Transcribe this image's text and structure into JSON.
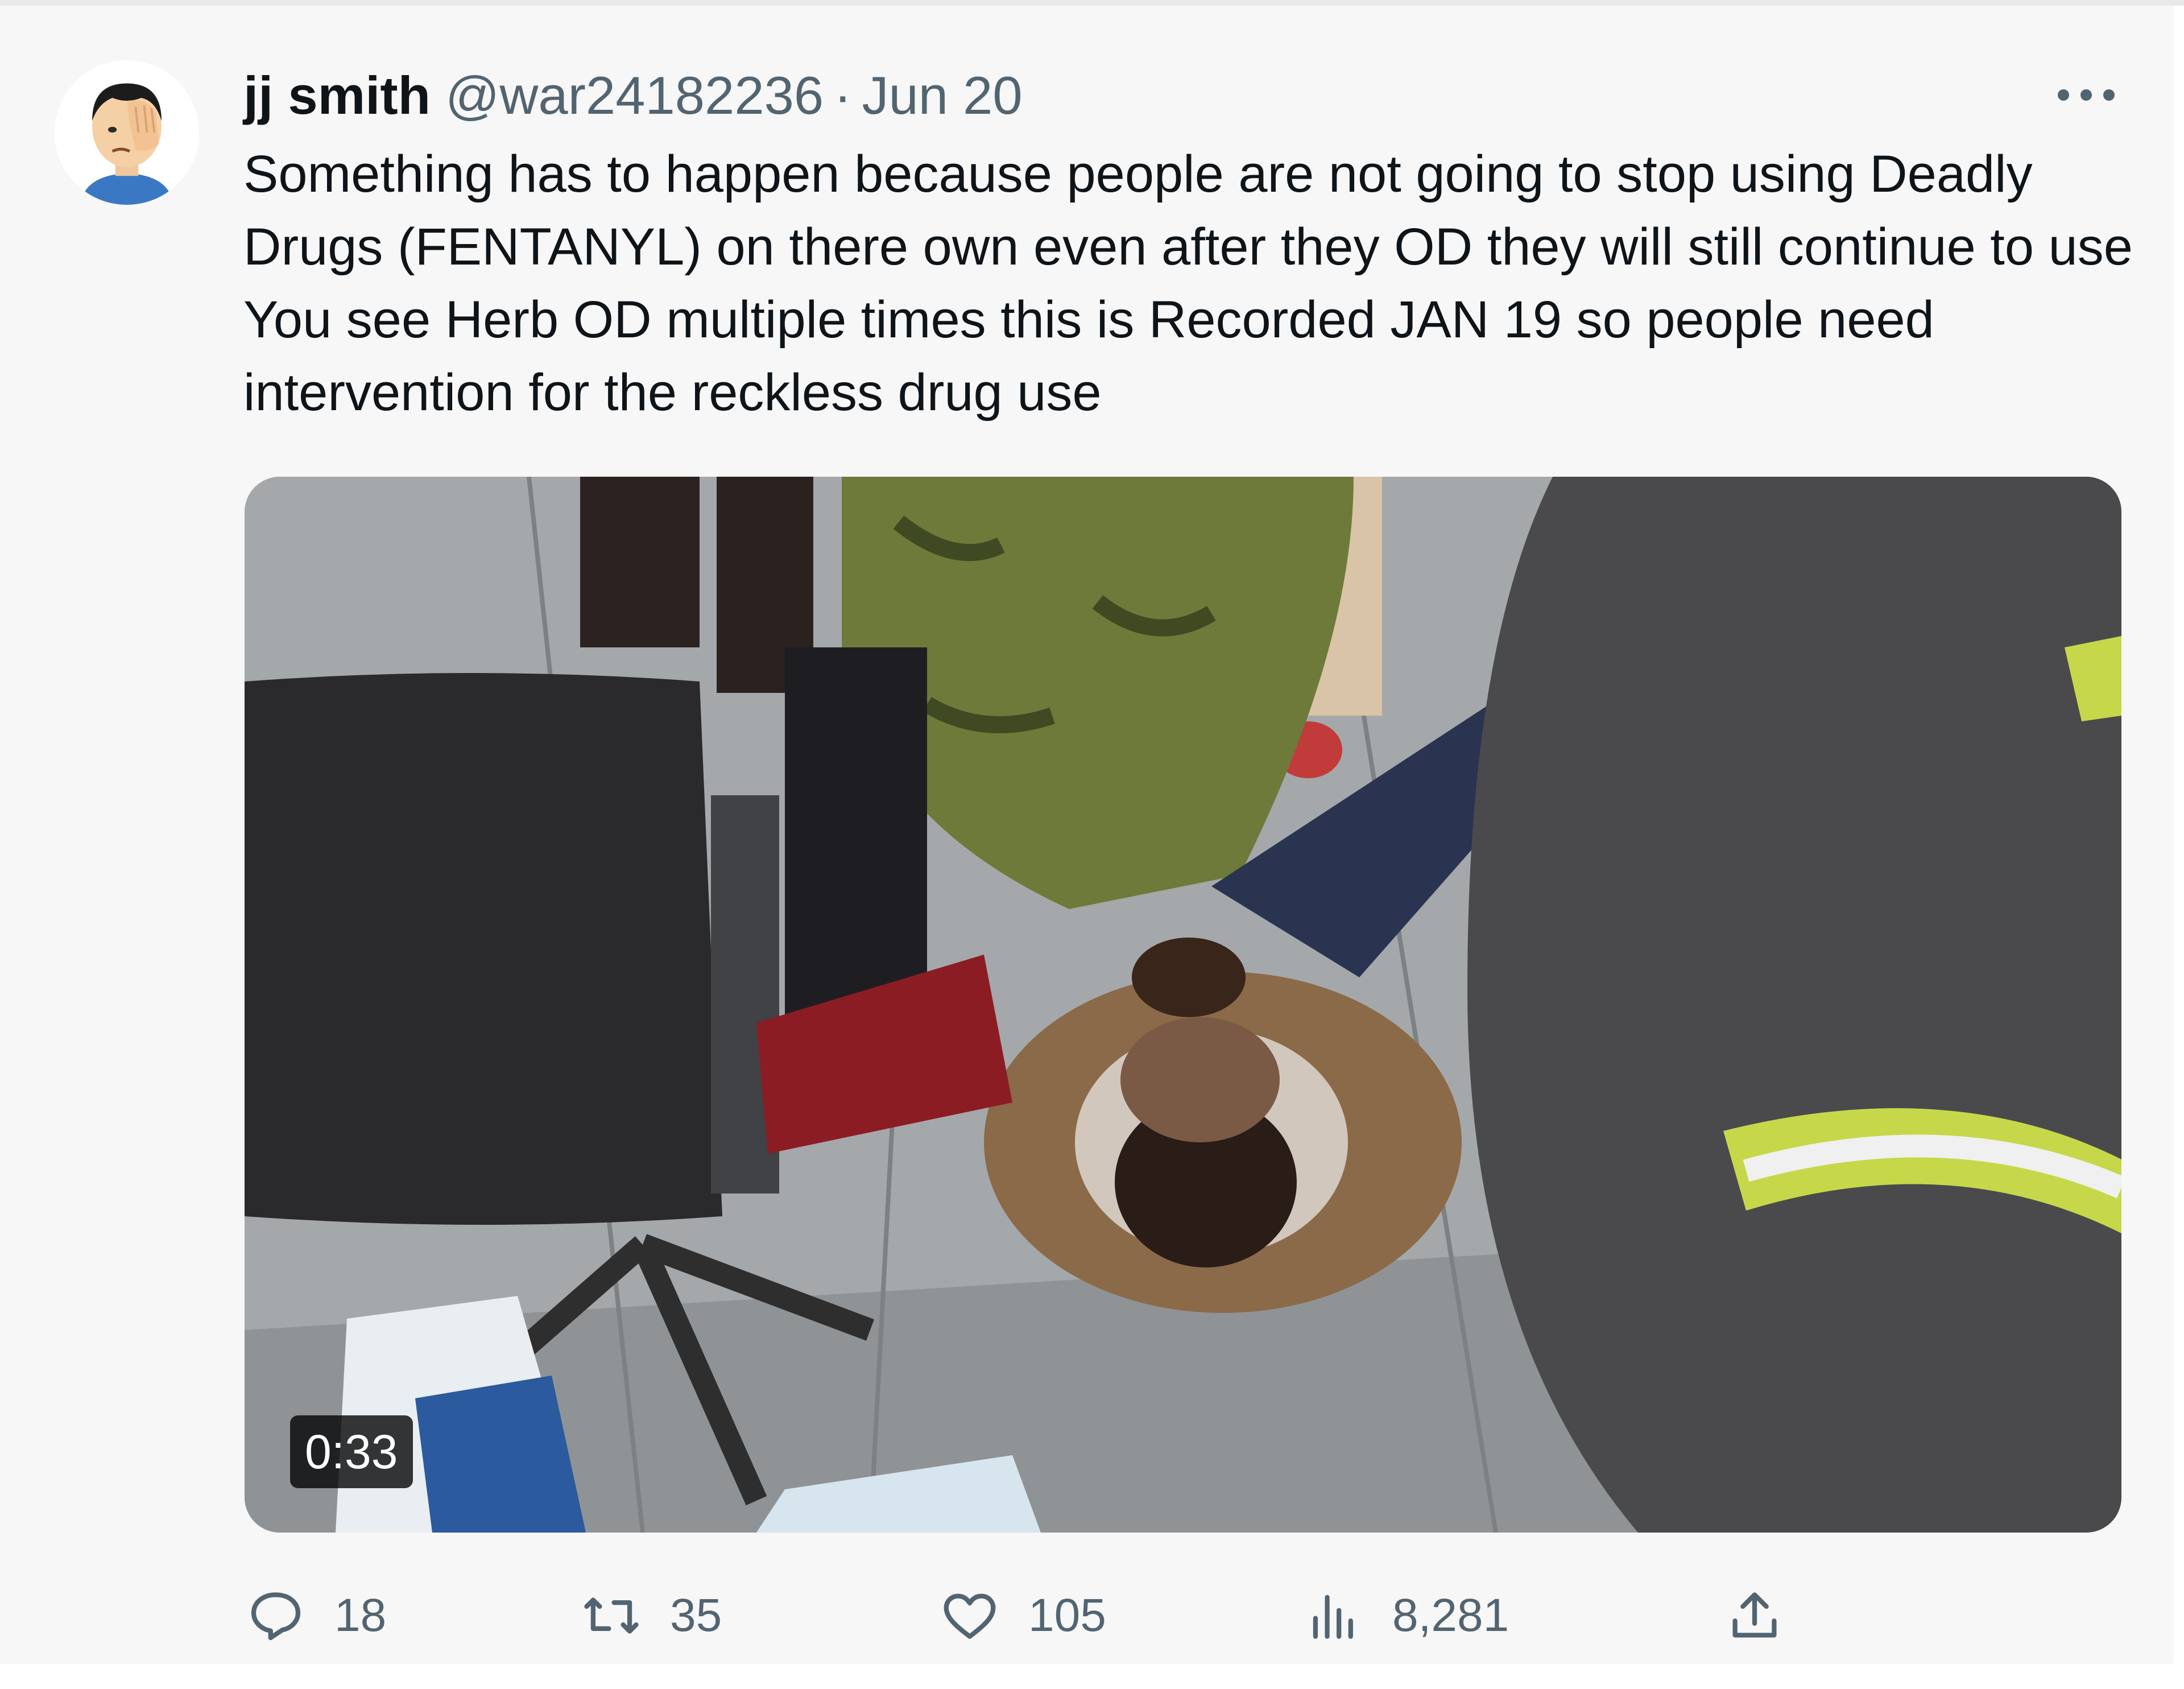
{
  "tweet": {
    "author_name": "jj smith",
    "handle": "@war24182236",
    "separator": "·",
    "date": "Jun 20",
    "text": "Something has to happen because people are not going to stop using Deadly Drugs (FENTANYL) on there own even after they OD they will still continue to use You see Herb OD multiple times this is Recorded JAN 19 so people need intervention for the reckless drug use",
    "avatar_icon": "face-palm-emoji-avatar",
    "more_icon": "more-dots-icon"
  },
  "media": {
    "type": "video",
    "duration": "0:33"
  },
  "actions": {
    "replies": "18",
    "retweets": "35",
    "likes": "105",
    "views": "8,281",
    "icons": [
      "reply-icon",
      "retweet-icon",
      "like-icon",
      "views-icon",
      "share-icon"
    ]
  },
  "colors": {
    "background": "#f7f7f7",
    "text": "#0f1419",
    "secondary_text": "#536471"
  }
}
